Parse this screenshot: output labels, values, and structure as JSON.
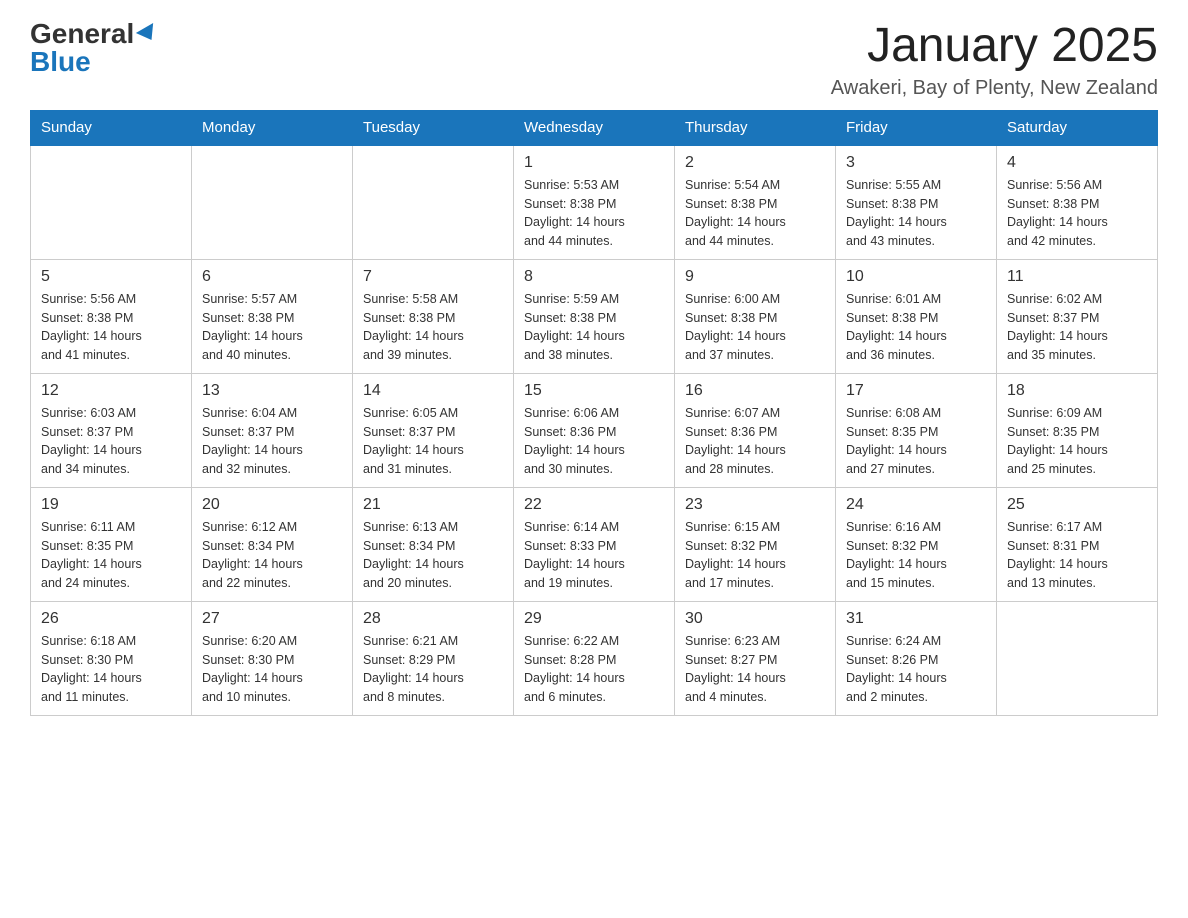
{
  "header": {
    "logo_general": "General",
    "logo_blue": "Blue",
    "month_title": "January 2025",
    "location": "Awakeri, Bay of Plenty, New Zealand"
  },
  "days_of_week": [
    "Sunday",
    "Monday",
    "Tuesday",
    "Wednesday",
    "Thursday",
    "Friday",
    "Saturday"
  ],
  "weeks": [
    [
      {
        "day": "",
        "info": ""
      },
      {
        "day": "",
        "info": ""
      },
      {
        "day": "",
        "info": ""
      },
      {
        "day": "1",
        "info": "Sunrise: 5:53 AM\nSunset: 8:38 PM\nDaylight: 14 hours\nand 44 minutes."
      },
      {
        "day": "2",
        "info": "Sunrise: 5:54 AM\nSunset: 8:38 PM\nDaylight: 14 hours\nand 44 minutes."
      },
      {
        "day": "3",
        "info": "Sunrise: 5:55 AM\nSunset: 8:38 PM\nDaylight: 14 hours\nand 43 minutes."
      },
      {
        "day": "4",
        "info": "Sunrise: 5:56 AM\nSunset: 8:38 PM\nDaylight: 14 hours\nand 42 minutes."
      }
    ],
    [
      {
        "day": "5",
        "info": "Sunrise: 5:56 AM\nSunset: 8:38 PM\nDaylight: 14 hours\nand 41 minutes."
      },
      {
        "day": "6",
        "info": "Sunrise: 5:57 AM\nSunset: 8:38 PM\nDaylight: 14 hours\nand 40 minutes."
      },
      {
        "day": "7",
        "info": "Sunrise: 5:58 AM\nSunset: 8:38 PM\nDaylight: 14 hours\nand 39 minutes."
      },
      {
        "day": "8",
        "info": "Sunrise: 5:59 AM\nSunset: 8:38 PM\nDaylight: 14 hours\nand 38 minutes."
      },
      {
        "day": "9",
        "info": "Sunrise: 6:00 AM\nSunset: 8:38 PM\nDaylight: 14 hours\nand 37 minutes."
      },
      {
        "day": "10",
        "info": "Sunrise: 6:01 AM\nSunset: 8:38 PM\nDaylight: 14 hours\nand 36 minutes."
      },
      {
        "day": "11",
        "info": "Sunrise: 6:02 AM\nSunset: 8:37 PM\nDaylight: 14 hours\nand 35 minutes."
      }
    ],
    [
      {
        "day": "12",
        "info": "Sunrise: 6:03 AM\nSunset: 8:37 PM\nDaylight: 14 hours\nand 34 minutes."
      },
      {
        "day": "13",
        "info": "Sunrise: 6:04 AM\nSunset: 8:37 PM\nDaylight: 14 hours\nand 32 minutes."
      },
      {
        "day": "14",
        "info": "Sunrise: 6:05 AM\nSunset: 8:37 PM\nDaylight: 14 hours\nand 31 minutes."
      },
      {
        "day": "15",
        "info": "Sunrise: 6:06 AM\nSunset: 8:36 PM\nDaylight: 14 hours\nand 30 minutes."
      },
      {
        "day": "16",
        "info": "Sunrise: 6:07 AM\nSunset: 8:36 PM\nDaylight: 14 hours\nand 28 minutes."
      },
      {
        "day": "17",
        "info": "Sunrise: 6:08 AM\nSunset: 8:35 PM\nDaylight: 14 hours\nand 27 minutes."
      },
      {
        "day": "18",
        "info": "Sunrise: 6:09 AM\nSunset: 8:35 PM\nDaylight: 14 hours\nand 25 minutes."
      }
    ],
    [
      {
        "day": "19",
        "info": "Sunrise: 6:11 AM\nSunset: 8:35 PM\nDaylight: 14 hours\nand 24 minutes."
      },
      {
        "day": "20",
        "info": "Sunrise: 6:12 AM\nSunset: 8:34 PM\nDaylight: 14 hours\nand 22 minutes."
      },
      {
        "day": "21",
        "info": "Sunrise: 6:13 AM\nSunset: 8:34 PM\nDaylight: 14 hours\nand 20 minutes."
      },
      {
        "day": "22",
        "info": "Sunrise: 6:14 AM\nSunset: 8:33 PM\nDaylight: 14 hours\nand 19 minutes."
      },
      {
        "day": "23",
        "info": "Sunrise: 6:15 AM\nSunset: 8:32 PM\nDaylight: 14 hours\nand 17 minutes."
      },
      {
        "day": "24",
        "info": "Sunrise: 6:16 AM\nSunset: 8:32 PM\nDaylight: 14 hours\nand 15 minutes."
      },
      {
        "day": "25",
        "info": "Sunrise: 6:17 AM\nSunset: 8:31 PM\nDaylight: 14 hours\nand 13 minutes."
      }
    ],
    [
      {
        "day": "26",
        "info": "Sunrise: 6:18 AM\nSunset: 8:30 PM\nDaylight: 14 hours\nand 11 minutes."
      },
      {
        "day": "27",
        "info": "Sunrise: 6:20 AM\nSunset: 8:30 PM\nDaylight: 14 hours\nand 10 minutes."
      },
      {
        "day": "28",
        "info": "Sunrise: 6:21 AM\nSunset: 8:29 PM\nDaylight: 14 hours\nand 8 minutes."
      },
      {
        "day": "29",
        "info": "Sunrise: 6:22 AM\nSunset: 8:28 PM\nDaylight: 14 hours\nand 6 minutes."
      },
      {
        "day": "30",
        "info": "Sunrise: 6:23 AM\nSunset: 8:27 PM\nDaylight: 14 hours\nand 4 minutes."
      },
      {
        "day": "31",
        "info": "Sunrise: 6:24 AM\nSunset: 8:26 PM\nDaylight: 14 hours\nand 2 minutes."
      },
      {
        "day": "",
        "info": ""
      }
    ]
  ]
}
